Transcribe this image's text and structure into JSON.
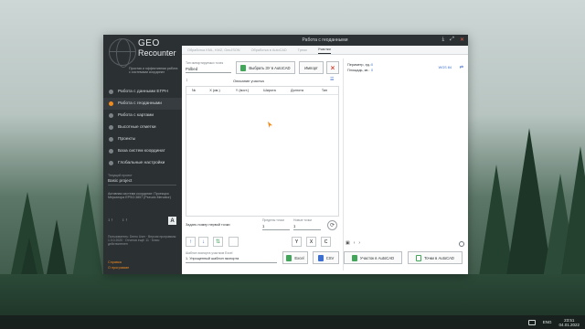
{
  "desktop": {
    "taskbar": {
      "lang": "ENG",
      "time": "23:51",
      "date": "04.01.2022"
    }
  },
  "sidebar": {
    "logo_line1": "GEO",
    "logo_line2": "Recounter",
    "tagline": "Простая и эффективная работа с системами координат",
    "nav": [
      {
        "label": "Работа с данными ЕГРН"
      },
      {
        "label": "Работа с геоданными"
      },
      {
        "label": "Работа с картами"
      },
      {
        "label": "Высотные отметки"
      },
      {
        "label": "Проекты"
      },
      {
        "label": "База систем координат"
      },
      {
        "label": "Глобальные настройки"
      }
    ],
    "project_label": "Текущий проект",
    "project_name": "Basic project",
    "crs_text": "Активная система координат: Проекция Меркатора EPSG:3857 (Pseudo Mercator)",
    "mini_btn_1": "↕ ↑",
    "mini_btn_2": "↕ ↑",
    "a_label": "A",
    "license_text": "Пользователь: Demo User · Версия программы: 1.0.0.2020 · Отчетов ещё: 11 · Ключ: действителен",
    "link_help": "Справка",
    "link_about": "О программе"
  },
  "window": {
    "title": "Работа с геоданными",
    "controls": [
      "⤓",
      "⤢",
      "✕"
    ]
  },
  "tabs": [
    "Обработка KML, KMZ, GeoJSON",
    "Обработка в AutoCAD",
    "Треки",
    "Участки"
  ],
  "active_tab": 3,
  "left": {
    "type_label": "Тип импортируемых точек",
    "type_value": "Polbed",
    "btn_select_autocad": "Выбрать ЗУ в AutoCAD",
    "btn_import": "Импорт",
    "description_label": "Описание участка",
    "grid_headers": [
      "№",
      "X (км.)",
      "Y (вост.)",
      "Широта",
      "Долгота",
      "Тип"
    ],
    "first_point_label": "Задать номер первой точки",
    "step_label": "Пределы точки",
    "step_value": "1",
    "new_point_label": "Новые точки",
    "new_point_value": "1",
    "letters": [
      "Y",
      "X",
      "C"
    ],
    "template_label": "Шаблон экспорта участков Excel",
    "template_value": "1. Упрощенный шаблон экспорта",
    "btn_excel": "Excel",
    "btn_csv": "CSV",
    "btn_parcel_autocad": "Участок в AutoCAD",
    "btn_points_autocad": "Точки в AutoCAD"
  },
  "right": {
    "perimeter_label": "Периметр, ед.:",
    "area_label": "Площадь, кв.:",
    "perimeter_value": "0",
    "area_value": "0",
    "map_badge": "WGS 84"
  }
}
